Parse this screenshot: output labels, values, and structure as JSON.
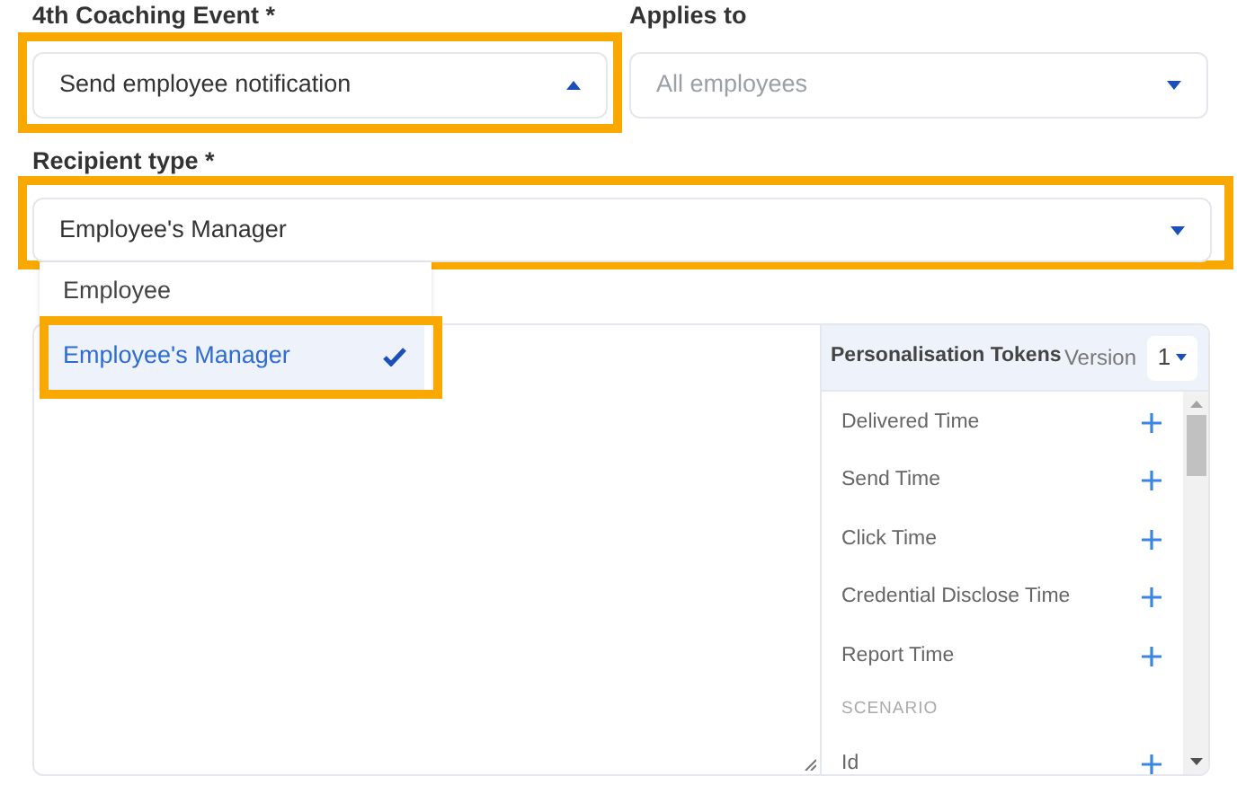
{
  "event_field": {
    "label": "4th Coaching Event *",
    "value": "Send employee notification",
    "expanded": true,
    "highlighted": true
  },
  "applies_field": {
    "label": "Applies to",
    "placeholder": "All employees"
  },
  "recipient_field": {
    "label": "Recipient type *",
    "value": "Employee's Manager",
    "highlighted": true
  },
  "recipient_options": [
    {
      "label": "Employee",
      "selected": false,
      "highlighted": false
    },
    {
      "label": "Employee's Manager",
      "selected": true,
      "highlighted": true
    }
  ],
  "tokens_panel": {
    "title": "Personalisation Tokens",
    "version_label": "Version",
    "version": "1",
    "items": [
      {
        "kind": "token",
        "label": "Delivered Time"
      },
      {
        "kind": "token",
        "label": "Send Time"
      },
      {
        "kind": "token",
        "label": "Click Time"
      },
      {
        "kind": "token",
        "label": "Credential Disclose Time"
      },
      {
        "kind": "token",
        "label": "Report Time"
      },
      {
        "kind": "heading",
        "label": "SCENARIO"
      },
      {
        "kind": "token",
        "label": "Id"
      }
    ]
  }
}
